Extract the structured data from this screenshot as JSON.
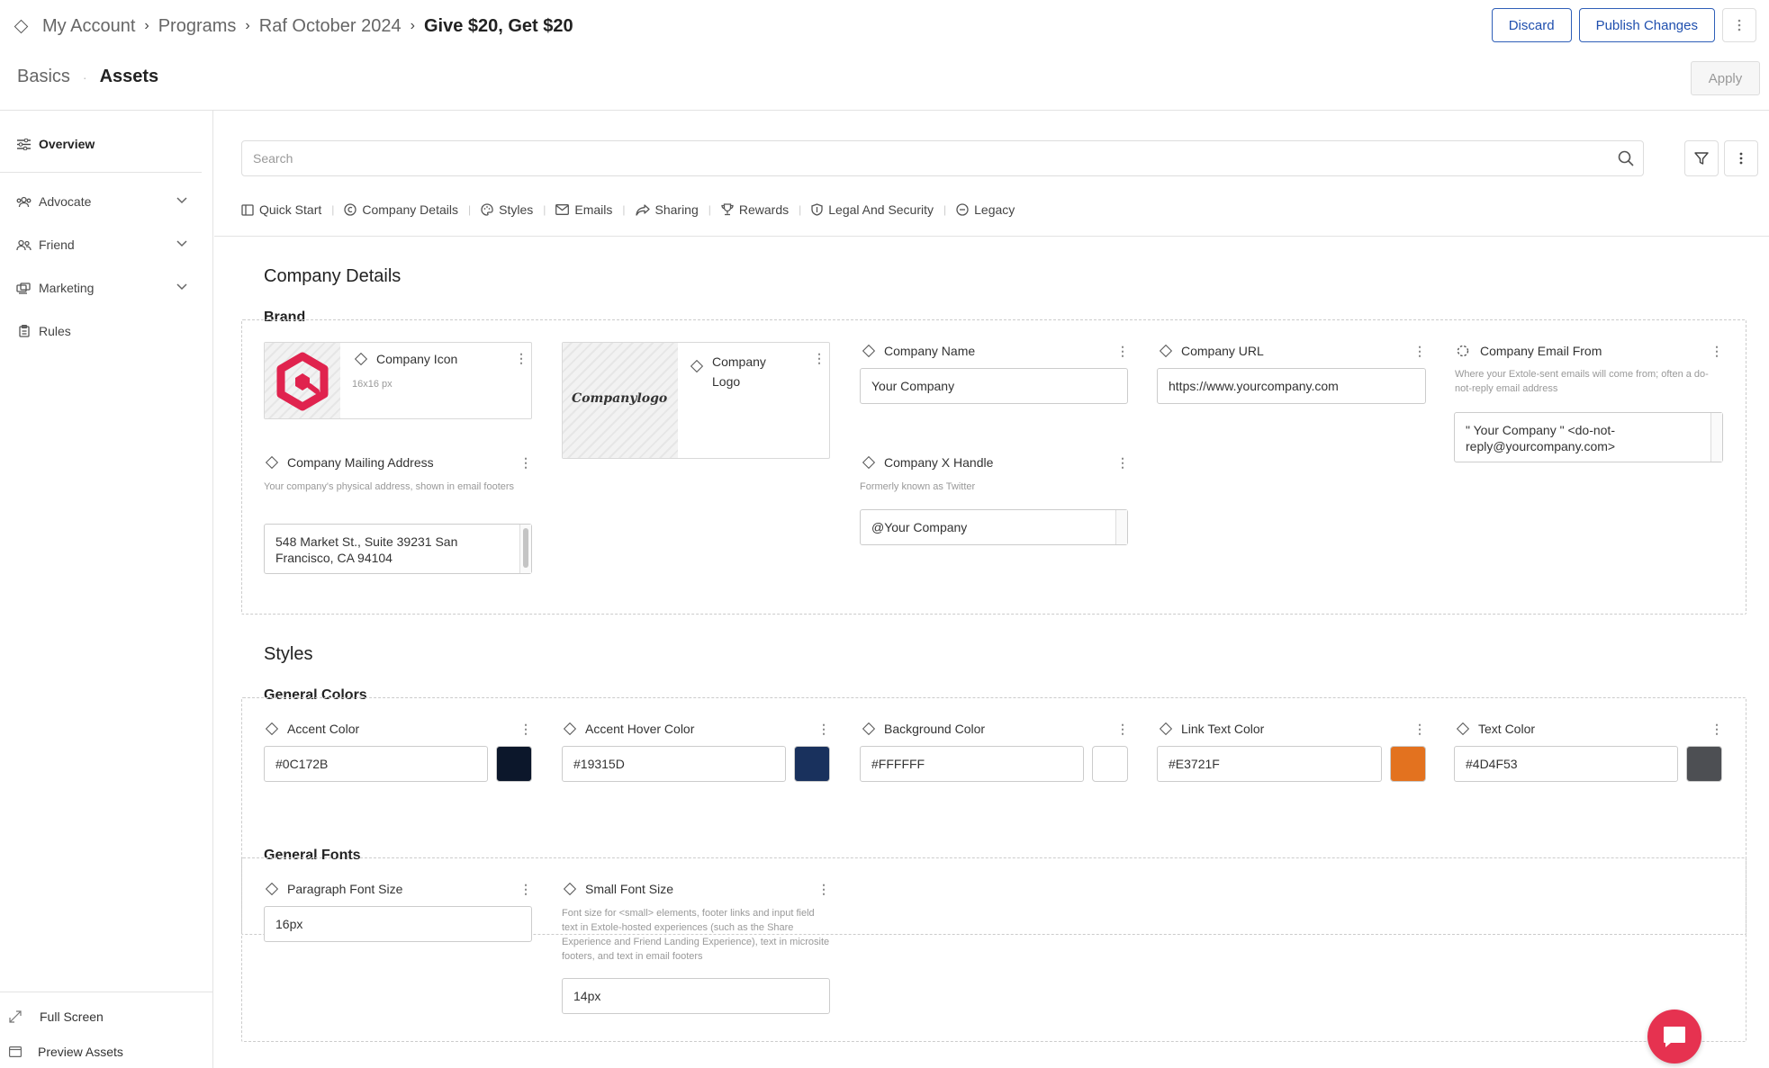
{
  "breadcrumb": {
    "items": [
      "My Account",
      "Programs",
      "Raf October 2024"
    ],
    "current": "Give $20, Get $20"
  },
  "header": {
    "discard_label": "Discard",
    "publish_label": "Publish Changes",
    "apply_label": "Apply"
  },
  "subtabs": [
    "Basics",
    "Assets"
  ],
  "sidebar": {
    "items": [
      {
        "label": "Overview",
        "icon": "sliders-icon"
      },
      {
        "label": "Advocate",
        "icon": "users-icon"
      },
      {
        "label": "Friend",
        "icon": "user-group-icon"
      },
      {
        "label": "Marketing",
        "icon": "campaign-icon"
      },
      {
        "label": "Rules",
        "icon": "clipboard-icon"
      }
    ],
    "bottom": [
      {
        "label": "Full Screen",
        "icon": "expand-icon"
      },
      {
        "label": "Preview Assets",
        "icon": "window-icon"
      }
    ]
  },
  "search": {
    "placeholder": "Search"
  },
  "nav_tabs": [
    {
      "label": "Quick Start",
      "icon": "start-icon"
    },
    {
      "label": "Company Details",
      "icon": "copyright-icon"
    },
    {
      "label": "Styles",
      "icon": "palette-icon"
    },
    {
      "label": "Emails",
      "icon": "mail-icon"
    },
    {
      "label": "Sharing",
      "icon": "share-icon"
    },
    {
      "label": "Rewards",
      "icon": "trophy-icon"
    },
    {
      "label": "Legal And Security",
      "icon": "shield-icon"
    },
    {
      "label": "Legacy",
      "icon": "minus-circle-icon"
    }
  ],
  "company_details": {
    "title": "Company Details",
    "brand_title": "Brand",
    "company_icon": {
      "label": "Company Icon",
      "hint": "16x16 px"
    },
    "company_logo": {
      "label": "Company Logo",
      "logo_text": "Companylogo"
    },
    "company_name": {
      "label": "Company Name",
      "value": "Your Company"
    },
    "company_url": {
      "label": "Company URL",
      "value": "https://www.yourcompany.com"
    },
    "company_email_from": {
      "label": "Company Email From",
      "hint": "Where your Extole-sent emails will come from; often a do-not-reply email address",
      "value": "\" Your Company \" <do-not-reply@yourcompany.com>"
    },
    "mailing_address": {
      "label": "Company Mailing Address",
      "hint": "Your company's physical address, shown in email footers",
      "value": "548 Market St., Suite 39231 San Francisco, CA 94104"
    },
    "x_handle": {
      "label": "Company X Handle",
      "hint": "Formerly known as Twitter",
      "value": "@Your Company"
    }
  },
  "styles": {
    "title": "Styles",
    "general_colors_title": "General Colors",
    "colors": [
      {
        "label": "Accent Color",
        "value": "#0C172B",
        "swatch": "#0C172B"
      },
      {
        "label": "Accent Hover Color",
        "value": "#19315D",
        "swatch": "#19315D"
      },
      {
        "label": "Background Color",
        "value": "#FFFFFF",
        "swatch": "#FFFFFF"
      },
      {
        "label": "Link Text Color",
        "value": "#E3721F",
        "swatch": "#E3721F"
      },
      {
        "label": "Text Color",
        "value": "#4D4F53",
        "swatch": "#4D4F53"
      }
    ],
    "general_fonts_title": "General Fonts",
    "paragraph_font": {
      "label": "Paragraph Font Size",
      "value": "16px"
    },
    "small_font": {
      "label": "Small Font Size",
      "hint": "Font size for <small> elements, footer links and input field text in Extole-hosted experiences (such as the Share Experience and Friend Landing Experience), text in microsite footers, and text in email footers",
      "value": "14px"
    }
  },
  "theme": {
    "accent": "#2f5fb8",
    "chat": "#e63250",
    "icon_red": "#e0234e"
  }
}
